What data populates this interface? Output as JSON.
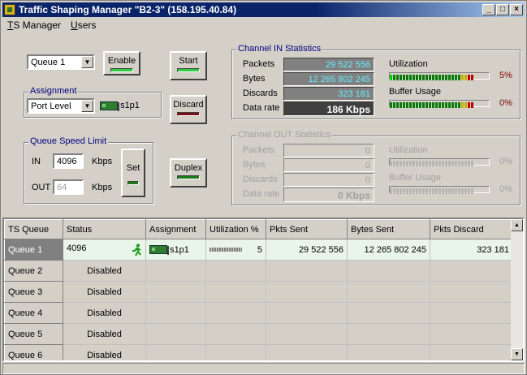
{
  "window": {
    "title": "Traffic Shaping Manager \"B2-3\" (158.195.40.84)",
    "min": "_",
    "max": "□",
    "close": "×"
  },
  "menu": [
    {
      "label": "TS Manager",
      "key": "T"
    },
    {
      "label": "Users",
      "key": "U"
    }
  ],
  "controls": {
    "queue_select": "Queue 1",
    "enable_label": "Enable",
    "start_label": "Start",
    "discard_label": "Discard",
    "duplex_label": "Duplex",
    "set_label": "Set",
    "assignment": {
      "caption": "Assignment",
      "select": "Port Level",
      "port": "s1p1"
    },
    "speed": {
      "caption": "Queue Speed Limit",
      "in_label": "IN",
      "in_value": "4096",
      "in_unit": "Kbps",
      "out_label": "OUT",
      "out_value": "64",
      "out_unit": "Kbps"
    }
  },
  "in_stats": {
    "caption": "Channel IN Statistics",
    "packets_label": "Packets",
    "packets": "29 522 556",
    "bytes_label": "Bytes",
    "bytes": "12 265 802 245",
    "discards_label": "Discards",
    "discards": "323 181",
    "rate_label": "Data rate",
    "rate": "186 Kbps",
    "util_label": "Utilization",
    "util_pct": "5%",
    "util_level": 0.05,
    "buffer_label": "Buffer Usage",
    "buffer_pct": "0%",
    "buffer_level": 0.0
  },
  "out_stats": {
    "caption": "Channel OUT Statistics",
    "packets_label": "Packets",
    "packets": "0",
    "bytes_label": "Bytes",
    "bytes": "0",
    "discards_label": "Discards",
    "discards": "0",
    "rate_label": "Data rate",
    "rate": "0 Kbps",
    "util_label": "Utilization",
    "util_pct": "0%",
    "buffer_label": "Buffer Usage",
    "buffer_pct": "0%"
  },
  "colors": {
    "led_on": "#2ecc40",
    "led_red": "#7a1010",
    "cyan": "#66eeff"
  },
  "table": {
    "headers": [
      "TS Queue",
      "Status",
      "Assignment",
      "Utilization %",
      "Pkts Sent",
      "Bytes Sent",
      "Pkts Discard"
    ],
    "rows": [
      {
        "queue": "Queue 1",
        "status": "4096",
        "assign": "s1p1",
        "util": "5",
        "sent": "29 522 556",
        "bytes": "12 265 802 245",
        "disc": "323 181",
        "active": true
      },
      {
        "queue": "Queue 2",
        "status": "Disabled"
      },
      {
        "queue": "Queue 3",
        "status": "Disabled"
      },
      {
        "queue": "Queue 4",
        "status": "Disabled"
      },
      {
        "queue": "Queue 5",
        "status": "Disabled"
      },
      {
        "queue": "Queue 6",
        "status": "Disabled"
      }
    ]
  }
}
